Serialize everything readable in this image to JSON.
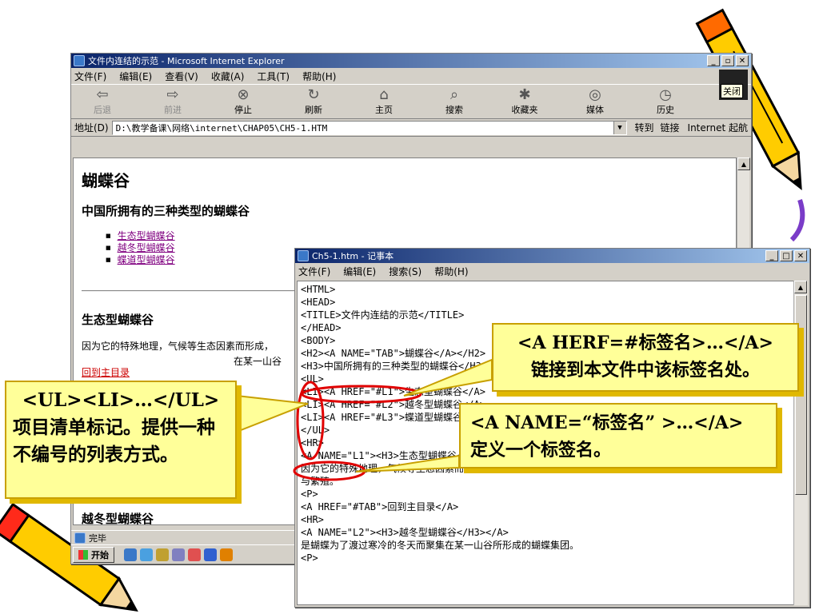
{
  "ie": {
    "title": "文件内连结的示范 - Microsoft Internet Explorer",
    "menu": [
      "文件(F)",
      "编辑(E)",
      "查看(V)",
      "收藏(A)",
      "工具(T)",
      "帮助(H)"
    ],
    "toolbar": [
      "后退",
      "前进",
      "停止",
      "刷新",
      "主页",
      "搜索",
      "收藏夹",
      "媒体",
      "历史"
    ],
    "close_badge": "关闭",
    "address_label": "地址(D)",
    "address": "D:\\教学备课\\网络\\internet\\CHAP05\\CH5-1.HTM",
    "go": "转到",
    "links": "链接",
    "internet": "Internet 起航",
    "page": {
      "h1": "蝴蝶谷",
      "h3": "中国所拥有的三种类型的蝴蝶谷",
      "list": [
        "生态型蝴蝶谷",
        "越冬型蝴蝶谷",
        "蝶道型蝴蝶谷"
      ],
      "section_title": "生态型蝴蝶谷",
      "section_text": "因为它的特殊地理，气候等生态因素而形成，",
      "back_link": "回到主目录",
      "partial_text": "在某一山谷",
      "next_heading": "越冬型蝴蝶谷"
    },
    "status": "完毕",
    "start": "开始"
  },
  "notepad": {
    "title": "Ch5-1.htm - 记事本",
    "menu": [
      "文件(F)",
      "编辑(E)",
      "搜索(S)",
      "帮助(H)"
    ],
    "code": "<HTML>\n<HEAD>\n<TITLE>文件内连结的示范</TITLE>\n</HEAD>\n<BODY>\n<H2><A NAME=\"TAB\">蝴蝶谷</A></H2>\n<H3>中国所拥有的三种类型的蝴蝶谷</H3>\n<UL>\n<LI><A HREF=\"#L1\">生态型蝴蝶谷</A>\n<LI><A HREF=\"#L2\">越冬型蝴蝶谷</A>\n<LI><A HREF=\"#L3\">蝶道型蝴蝶谷</A>\n</UL>\n<HR>\n<A NAME=\"L1\"><H3>生态型蝴蝶谷</H3></A>\n因为它的特殊地理，气候等生态因素而形成，仅适合某种特定蝴蝶生存\n与繁殖。\n<P>\n<A HREF=\"#TAB\">回到主目录</A>\n<HR>\n<A NAME=\"L2\"><H3>越冬型蝴蝶谷</H3></A>\n是蝴蝶为了渡过寒冷的冬天而聚集在某一山谷所形成的蝴蝶集团。\n<P>"
  },
  "callouts": {
    "ul_line1": "<UL><LI>…</UL>",
    "ul_line2": "项目清单标记。提供一种不编号的列表方式。",
    "href_line1": "<A HERF=#标签名>…</A>",
    "href_line2": "链接到本文件中该标签名处。",
    "name_line1": "<A NAME=“标签名” >…</A>",
    "name_line2": "定义一个标签名。"
  },
  "colors": {
    "highlight": "#e00000",
    "callout_bg": "#ffff99",
    "pencil": "#ffcc00"
  }
}
